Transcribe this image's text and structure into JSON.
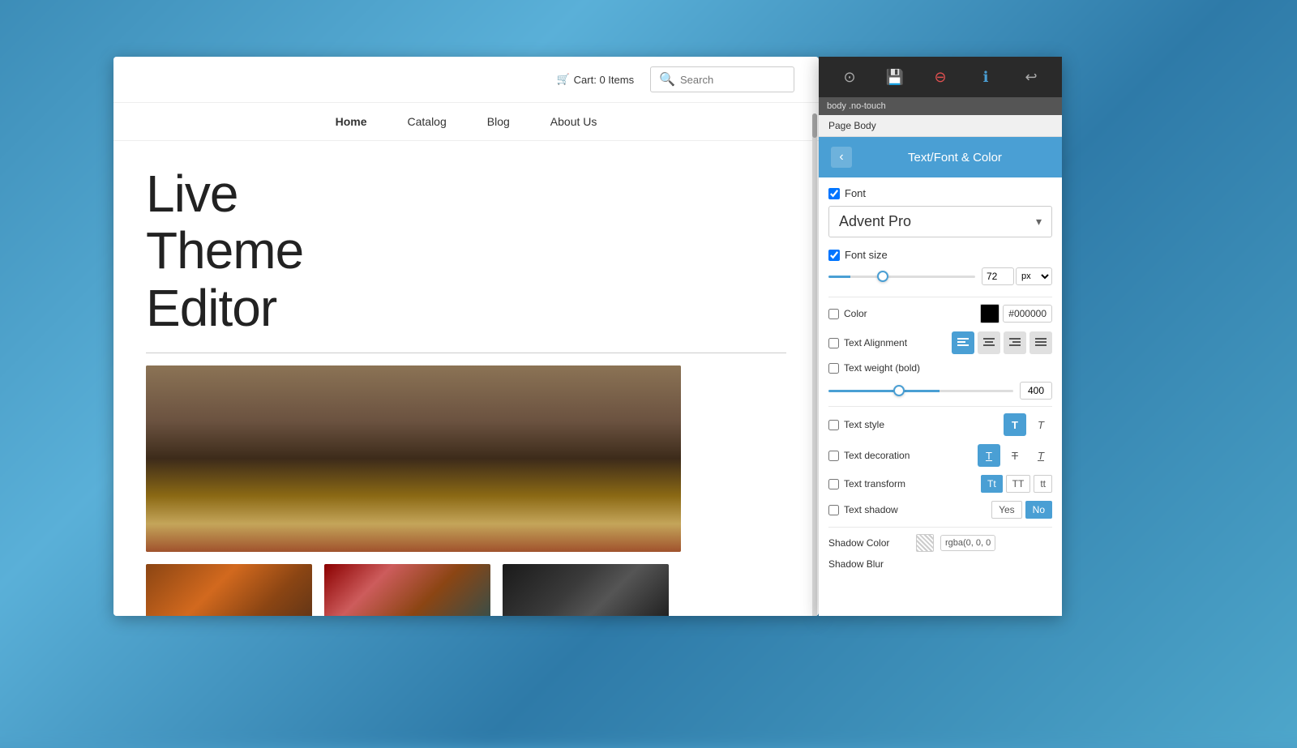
{
  "background": {
    "color": "#4a9cc7"
  },
  "browser": {
    "scrollbar_visible": true
  },
  "website": {
    "cart_label": "Cart: 0 Items",
    "search_placeholder": "Search",
    "nav_items": [
      "Home",
      "Catalog",
      "Blog",
      "About Us"
    ],
    "nav_active": "Home",
    "hero_title_line1": "Live",
    "hero_title_line2": "Theme",
    "hero_title_line3": "Editor"
  },
  "toolbar": {
    "icons": [
      "⊙",
      "💾",
      "⊖",
      "ℹ",
      "↩"
    ]
  },
  "panel": {
    "selector_bar_text": "body .no-touch",
    "page_body_label": "Page Body",
    "back_btn_label": "‹",
    "title": "Text/Font & Color",
    "font_section": {
      "checkbox_checked": true,
      "label": "Font",
      "value": "Advent Pro",
      "arrow": "▾"
    },
    "font_size_section": {
      "checkbox_checked": true,
      "label": "Font size",
      "slider_value": 72,
      "slider_unit": "px",
      "slider_pct": 15
    },
    "color_section": {
      "checkbox_checked": false,
      "label": "Color",
      "value": "#000000",
      "swatch_color": "#000000"
    },
    "text_alignment": {
      "checkbox_checked": false,
      "label": "Text Alignment",
      "buttons": [
        "≡",
        "≡",
        "≡",
        "≡"
      ],
      "active_index": 0
    },
    "text_weight": {
      "checkbox_checked": false,
      "label": "Text weight (bold)",
      "value": 400,
      "slider_pct": 60
    },
    "text_style": {
      "checkbox_checked": false,
      "label": "Text style",
      "buttons": [
        {
          "label": "T",
          "active": true,
          "bold": true
        },
        {
          "label": "T",
          "active": false,
          "italic": true
        }
      ]
    },
    "text_decoration": {
      "checkbox_checked": false,
      "label": "Text decoration",
      "buttons": [
        {
          "label": "T̲",
          "active": true
        },
        {
          "label": "T̶",
          "active": false
        },
        {
          "label": "T̷",
          "active": false
        }
      ]
    },
    "text_transform": {
      "checkbox_checked": false,
      "label": "Text transform",
      "buttons": [
        {
          "label": "Tt",
          "active": true
        },
        {
          "label": "TT",
          "active": false
        },
        {
          "label": "tt",
          "active": false
        }
      ]
    },
    "text_shadow": {
      "checkbox_checked": false,
      "label": "Text shadow",
      "yes_label": "Yes",
      "no_label": "No",
      "no_active": true
    },
    "shadow_color": {
      "label": "Shadow Color",
      "value": "rgba(0, 0, 0"
    },
    "shadow_blur": {
      "label": "Shadow Blur"
    }
  }
}
